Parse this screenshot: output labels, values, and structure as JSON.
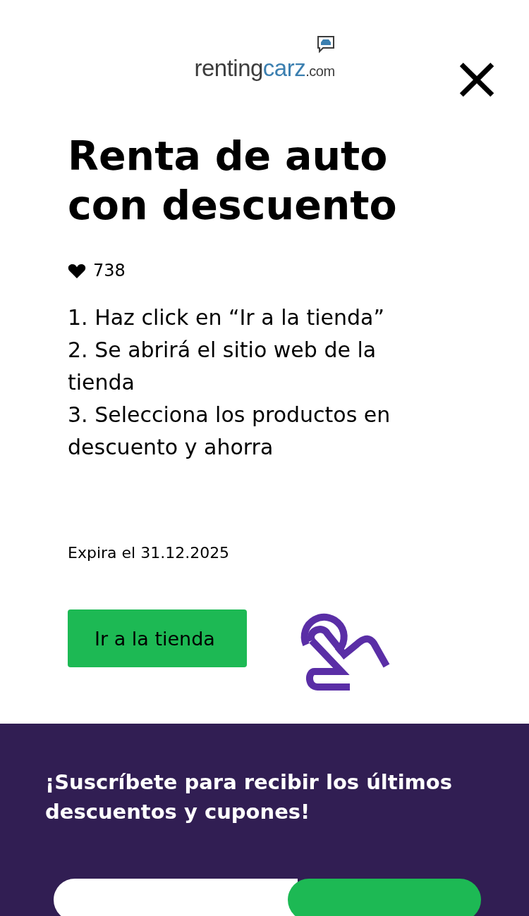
{
  "logo": {
    "brand": "renting",
    "accent": "carz",
    "suffix": ".com"
  },
  "close": {
    "symbol": "×"
  },
  "title": "Renta de auto con descuento",
  "likes": "738",
  "steps": [
    "1. Haz click en “Ir a la tienda”",
    "2. Se abrirá el sitio web de la tienda",
    "3. Selecciona los productos en descuento y ahorra"
  ],
  "expiry": "Expira el 31.12.2025",
  "cta": {
    "label": "Ir a la tienda"
  },
  "newsletter": {
    "heading": "¡Suscríbete para recibir los últimos descuentos y cupones!"
  }
}
